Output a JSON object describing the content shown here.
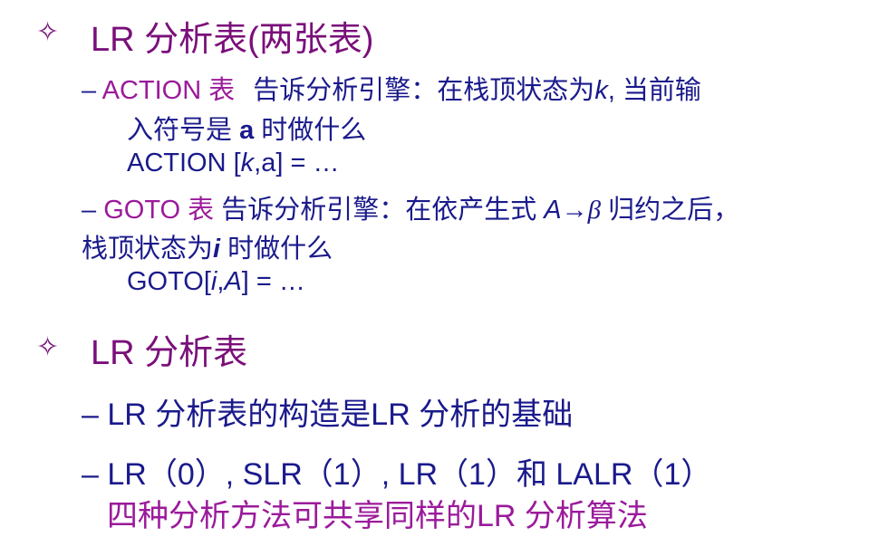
{
  "section1": {
    "bullet": "✧",
    "title": "LR 分析表(两张表)",
    "action": {
      "dash": "–",
      "label": "ACTION 表",
      "desc1": "告诉分析引擎：在栈顶状态为",
      "k": "k",
      "desc2": ", 当前输",
      "line2a": "入符号是 ",
      "line2b": "a",
      "line2c": " 时做什么",
      "formula_a": "ACTION [",
      "formula_k": "k",
      "formula_b": ",a] = …"
    },
    "goto": {
      "dash": "–",
      "label": "GOTO 表",
      "desc1": "告诉分析引擎：在依产生式 ",
      "A": "A",
      "arrow": "→",
      "beta": "β",
      "desc2": " 归约之后，",
      "line2a": "栈顶状态为",
      "i": "i",
      "line2b": " 时做什么",
      "formula_a": "GOTO[",
      "formula_i": "i",
      "formula_comma": ",",
      "formula_A": "A",
      "formula_b": "] = …"
    }
  },
  "section2": {
    "bullet": "✧",
    "title": "LR 分析表",
    "item1": {
      "dash": "–",
      "text": "LR 分析表的构造是LR 分析的基础"
    },
    "item2": {
      "dash": "–",
      "text": "LR（0）, SLR（1）, LR（1）和 LALR（1）",
      "line2": "四种分析方法可共享同样的LR 分析算法"
    }
  }
}
